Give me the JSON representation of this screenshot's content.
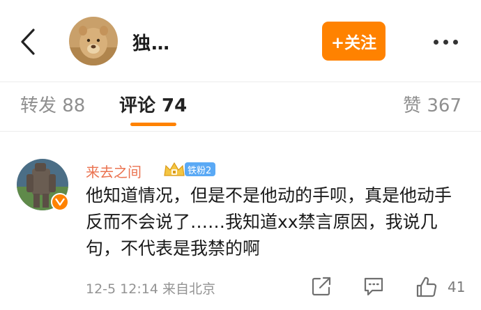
{
  "header": {
    "user_name": "独…",
    "follow_label": "+关注"
  },
  "tabs": [
    {
      "label": "转发 88"
    },
    {
      "label": "评论 74"
    },
    {
      "label": "赞 367"
    }
  ],
  "comment": {
    "author": "来去之间",
    "fan_badge": "铁粉2",
    "text": "他知道情况，但是不是他动的手呗，真是他动手反而不会说了……我知道xx禁言原因，我说几句，不代表是我禁的啊",
    "meta": "12-5 12:14 来自北京",
    "like_count": "41"
  },
  "colors": {
    "accent": "#ff8200",
    "commenter_name": "#eb7350",
    "fan_badge": "#5aa9f5"
  },
  "icons": {
    "back": "chevron-left-icon",
    "more": "more-dots-icon",
    "share": "share-icon",
    "reply": "comment-icon",
    "like": "thumbs-up-icon",
    "verified": "verified-v-icon",
    "crown": "crown-icon"
  }
}
